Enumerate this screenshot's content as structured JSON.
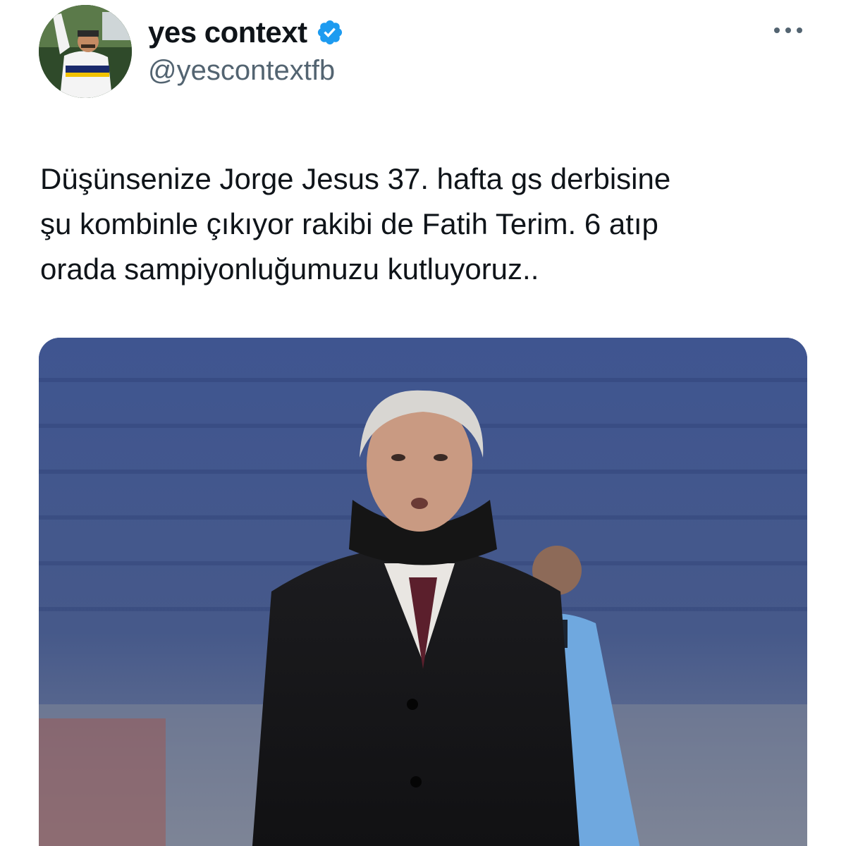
{
  "author": {
    "display_name": "yes context",
    "handle": "@yescontextfb",
    "verified": true,
    "avatar_icon": "profile-photo"
  },
  "tweet": {
    "text": "Düşünsenize Jorge Jesus 37. hafta gs derbisine\nşu kombinle çıkıyor rakibi de Fatih Terim. 6 atıp\norada sampiyonluğumuzu kutluyoruz.."
  },
  "actions": {
    "more_icon": "more-horizontal-icon"
  },
  "colors": {
    "verified_blue": "#1d9bf0",
    "text_primary": "#0f1419",
    "text_secondary": "#536471"
  },
  "media": {
    "type": "photo"
  }
}
